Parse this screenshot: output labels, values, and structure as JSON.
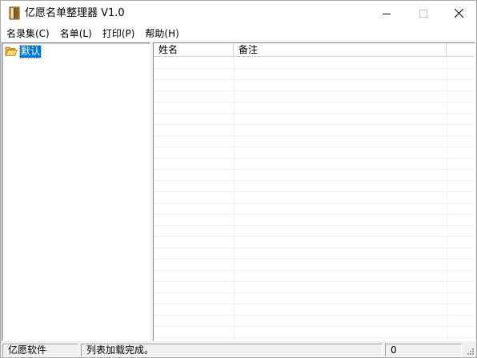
{
  "window": {
    "title": "亿愿名单整理器 V1.0",
    "icon": "book-icon",
    "controls": {
      "minimize": "─",
      "maximize": "☐",
      "close": "✕"
    }
  },
  "menubar": {
    "items": [
      {
        "label": "名录集(C)"
      },
      {
        "label": "名单(L)"
      },
      {
        "label": "打印(P)"
      },
      {
        "label": "帮助(H)"
      }
    ]
  },
  "tree": {
    "nodes": [
      {
        "label": "默认",
        "icon": "open-folder-icon",
        "selected": true
      }
    ]
  },
  "list": {
    "columns": [
      {
        "label": "姓名"
      },
      {
        "label": "备注"
      },
      {
        "label": ""
      }
    ],
    "rows": []
  },
  "statusbar": {
    "left": "亿愿软件",
    "message": "列表加载完成。",
    "count": "0"
  },
  "colors": {
    "selection": "#0078d7",
    "chrome": "#f0f0f0",
    "folder": "#f5c84c"
  }
}
